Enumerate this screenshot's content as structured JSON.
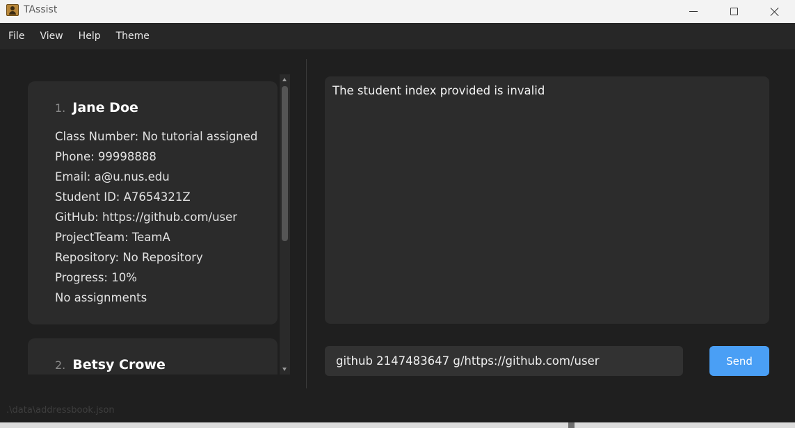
{
  "window": {
    "title": "TAssist",
    "icon": "app-logo-icon",
    "controls": [
      "minimize-icon",
      "maximize-icon",
      "close-icon"
    ]
  },
  "menu": {
    "items": [
      {
        "label": "File"
      },
      {
        "label": "View"
      },
      {
        "label": "Help"
      },
      {
        "label": "Theme"
      }
    ]
  },
  "students": [
    {
      "index": "1.",
      "name": "Jane Doe",
      "lines": [
        "Class Number: No tutorial assigned",
        "Phone: 99998888",
        "Email: a@u.nus.edu",
        "Student ID: A7654321Z",
        "GitHub: https://github.com/user",
        "ProjectTeam: TeamA",
        "Repository: No Repository",
        "Progress: 10%",
        "No assignments"
      ]
    },
    {
      "index": "2.",
      "name": "Betsy Crowe"
    }
  ],
  "result": {
    "message": "The student index provided is invalid"
  },
  "command": {
    "value": "github 2147483647 g/https://github.com/user",
    "send_label": "Send"
  },
  "status": {
    "file_path": ".\\data\\addressbook.json"
  },
  "colors": {
    "background": "#1f1f1f",
    "card": "#2b2b2b",
    "accent": "#4a9ff5"
  }
}
